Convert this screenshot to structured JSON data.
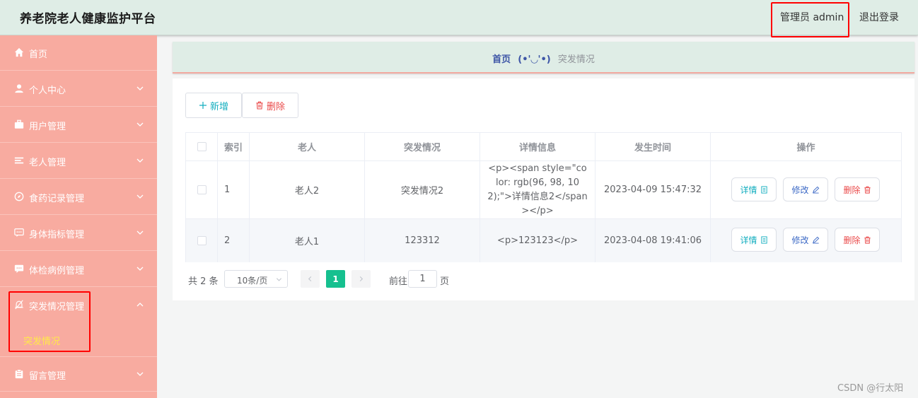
{
  "header": {
    "title": "养老院老人健康监护平台",
    "admin": "管理员 admin",
    "logout": "退出登录"
  },
  "sidebar": {
    "items": [
      {
        "label": "首页",
        "icon": "home-icon"
      },
      {
        "label": "个人中心",
        "icon": "user-icon"
      },
      {
        "label": "用户管理",
        "icon": "briefcase-icon"
      },
      {
        "label": "老人管理",
        "icon": "list-icon"
      },
      {
        "label": "食药记录管理",
        "icon": "compass-icon"
      },
      {
        "label": "身体指标管理",
        "icon": "chat-dots-icon"
      },
      {
        "label": "体检病例管理",
        "icon": "chat-icon"
      },
      {
        "label": "突发情况管理",
        "icon": "bell-off-icon"
      },
      {
        "label": "留言管理",
        "icon": "clipboard-icon"
      }
    ],
    "active_sub": "突发情况"
  },
  "breadcrumb": {
    "home": "首页",
    "separator": "(•'◡'•)",
    "current": "突发情况"
  },
  "toolbar": {
    "add_label": "新增",
    "delete_label": "删除"
  },
  "table": {
    "headers": [
      "索引",
      "老人",
      "突发情况",
      "详情信息",
      "发生时间",
      "操作"
    ],
    "rows": [
      {
        "index": "1",
        "elder": "老人2",
        "emergency": "突发情况2",
        "detail": "<p><span style=\"color: rgb(96, 98, 102);\">详情信息2</span></p>",
        "time": "2023-04-09 15:47:32"
      },
      {
        "index": "2",
        "elder": "老人1",
        "emergency": "123312",
        "detail": "<p>123123</p>",
        "time": "2023-04-08 19:41:06"
      }
    ],
    "actions": {
      "detail": "详情",
      "edit": "修改",
      "delete": "删除"
    }
  },
  "pagination": {
    "total": "共 2 条",
    "page_size": "10条/页",
    "current_page": "1",
    "goto_label": "前往",
    "goto_value": "1",
    "page_suffix": "页"
  },
  "watermark": "CSDN @行太阳",
  "colors": {
    "header_bg": "#dfede6",
    "sidebar_bg": "#f8aba0",
    "active_sub": "#ffe94a",
    "primary": "#16c08f",
    "danger": "#ea4a4a",
    "highlight_box": "#ff0000"
  }
}
